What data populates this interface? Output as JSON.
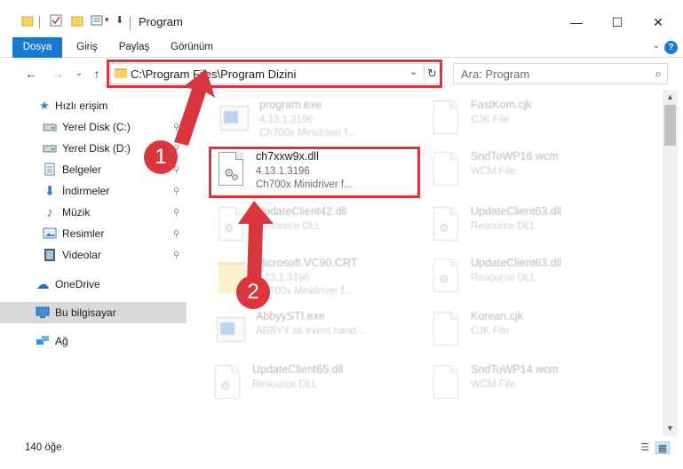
{
  "window": {
    "title": "Program",
    "minimize_glyph": "—",
    "maximize_glyph": "☐",
    "close_glyph": "✕"
  },
  "ribbon": {
    "tabs": [
      "Dosya",
      "Giriş",
      "Paylaş",
      "Görünüm"
    ],
    "help_glyph": "?"
  },
  "nav": {
    "back_glyph": "←",
    "forward_glyph": "→",
    "recent_glyph": "⌄",
    "up_glyph": "↑",
    "address": "C:\\Program Files\\Program Dizini",
    "dropdown_glyph": "⌄",
    "refresh_glyph": "↻",
    "search_placeholder": "Ara: Program",
    "search_glyph": "⌕"
  },
  "sidebar": {
    "items": [
      {
        "label": "Hızlı erişim",
        "icon": "star-icon",
        "glyph": "★",
        "color": "#2c7cd3",
        "pinned": false
      },
      {
        "label": "Yerel Disk (C:)",
        "icon": "drive-icon",
        "glyph": "▬",
        "color": "#6a6a6a",
        "pinned": true
      },
      {
        "label": "Yerel Disk (D:)",
        "icon": "drive-icon",
        "glyph": "▬",
        "color": "#6a6a6a",
        "pinned": true
      },
      {
        "label": "Belgeler",
        "icon": "documents-icon",
        "glyph": "▤",
        "color": "#5b7fa8",
        "pinned": true
      },
      {
        "label": "İndirmeler",
        "icon": "download-icon",
        "glyph": "⬇",
        "color": "#2c7cd3",
        "pinned": true
      },
      {
        "label": "Müzik",
        "icon": "music-icon",
        "glyph": "♪",
        "color": "#2c7cd3",
        "pinned": true
      },
      {
        "label": "Resimler",
        "icon": "pictures-icon",
        "glyph": "▣",
        "color": "#4f7fb5",
        "pinned": true
      },
      {
        "label": "Videolar",
        "icon": "videos-icon",
        "glyph": "▦",
        "color": "#555555",
        "pinned": true
      },
      {
        "label": "OneDrive",
        "icon": "cloud-icon",
        "glyph": "☁",
        "color": "#1f6fc5",
        "pinned": false
      },
      {
        "label": "Bu bilgisayar",
        "icon": "computer-icon",
        "glyph": "▭",
        "color": "#2c7cd3",
        "pinned": false
      },
      {
        "label": "Ağ",
        "icon": "network-icon",
        "glyph": "⛭",
        "color": "#2c7cd3",
        "pinned": false
      }
    ],
    "pin_glyph": "📌"
  },
  "files": [
    {
      "name": "program.exe",
      "meta1": "4.13.1.3196",
      "meta2": "Ch700x Minidriver f...",
      "kind": "exe",
      "faded": true
    },
    {
      "name": "FastKom.cjk",
      "meta1": "CJK File",
      "meta2": "",
      "kind": "doc",
      "faded": true
    },
    {
      "name": "ch7xxw9x.dll",
      "meta1": "4.13.1.3196",
      "meta2": "Ch700x Minidriver f...",
      "kind": "dll",
      "faded": false
    },
    {
      "name": "SndToWP16.wcm",
      "meta1": "WCM File",
      "meta2": "",
      "kind": "doc",
      "faded": true
    },
    {
      "name": "UpdateClient42.dll",
      "meta1": "Resource DLL",
      "meta2": "",
      "kind": "dll",
      "faded": true
    },
    {
      "name": "UpdateClient63.dll",
      "meta1": "Resource DLL",
      "meta2": "",
      "kind": "dll",
      "faded": true
    },
    {
      "name": "Microsoft.VC90.CRT",
      "meta1": "4.13.1.3196",
      "meta2": "Ch700x Minidriver f...",
      "kind": "folder",
      "faded": true
    },
    {
      "name": "UpdateClient63.dll",
      "meta1": "Resource DLL",
      "meta2": "",
      "kind": "dll",
      "faded": true
    },
    {
      "name": "AbbyySTI.exe",
      "meta1": "ABBYY sti event hand...",
      "meta2": "",
      "kind": "exe",
      "faded": true
    },
    {
      "name": "Korean.cjk",
      "meta1": "CJK File",
      "meta2": "",
      "kind": "doc",
      "faded": true
    },
    {
      "name": "UpdateClient65.dll",
      "meta1": "Resource DLL",
      "meta2": "",
      "kind": "dll",
      "faded": true
    },
    {
      "name": "SndToWP14.wcm",
      "meta1": "WCM File",
      "meta2": "",
      "kind": "doc",
      "faded": true
    }
  ],
  "annotations": {
    "step1": "1",
    "step2": "2",
    "highlight_color": "#d9363e"
  },
  "status": {
    "item_count": "140 öğe"
  }
}
